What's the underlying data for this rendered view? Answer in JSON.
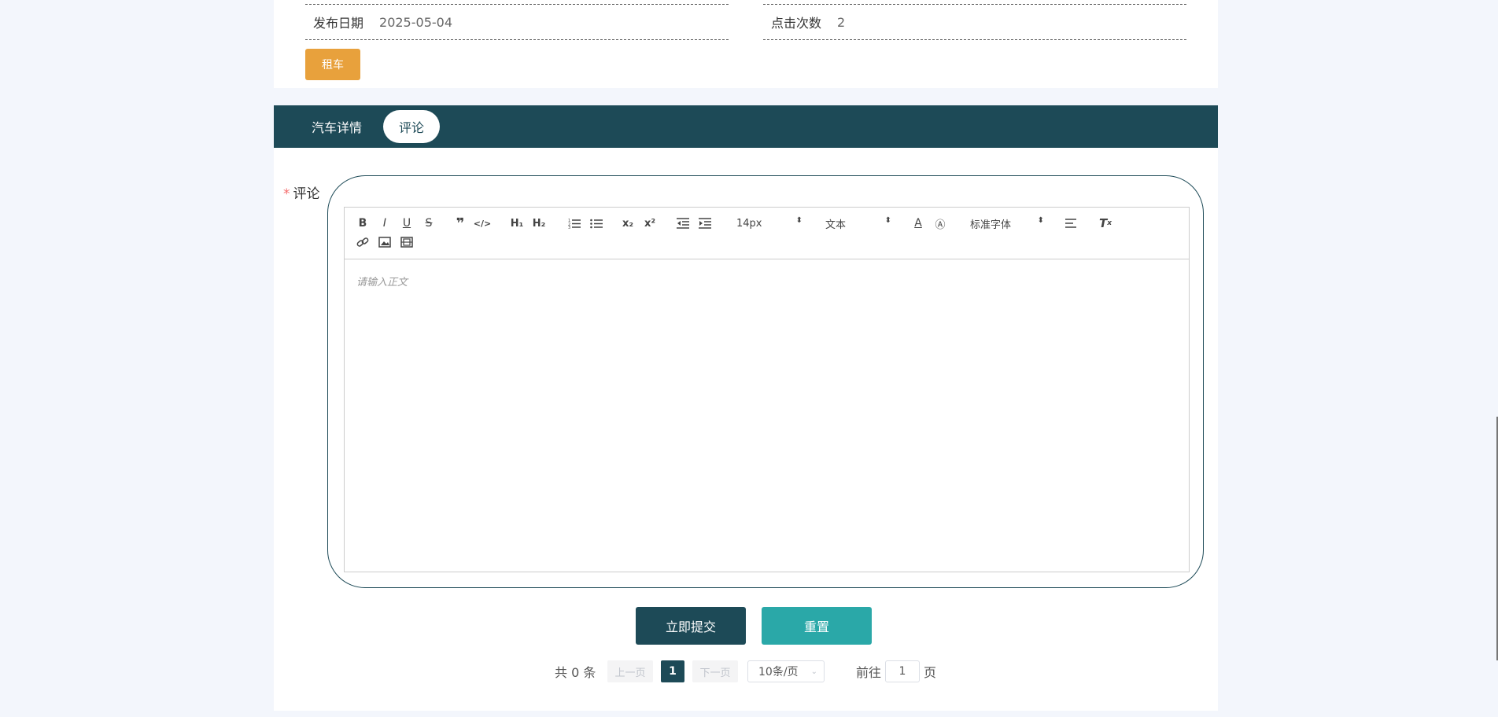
{
  "info": {
    "publish_date_label": "发布日期",
    "publish_date_value": "2025-05-04",
    "clicks_label": "点击次数",
    "clicks_value": "2"
  },
  "rent_button": "租车",
  "tabs": [
    {
      "label": "汽车详情",
      "active": false
    },
    {
      "label": "评论",
      "active": true
    }
  ],
  "form": {
    "required_mark": "*",
    "comment_label": "评论"
  },
  "editor": {
    "toolbar": {
      "bold": "B",
      "italic": "I",
      "underline": "U",
      "strike": "S",
      "h1": "H₁",
      "h2": "H₂",
      "subscript": "x₂",
      "superscript": "x²",
      "size_value": "14px",
      "header_value": "文本",
      "font_value": "标准字体"
    },
    "placeholder": "请输入正文"
  },
  "buttons": {
    "submit": "立即提交",
    "reset": "重置"
  },
  "pagination": {
    "total_text": "共 0 条",
    "prev": "上一页",
    "current_page": "1",
    "next": "下一页",
    "page_size": "10条/页",
    "goto_prefix": "前往",
    "goto_value": "1",
    "goto_suffix": "页"
  },
  "colors": {
    "primary": "#1d4a57",
    "rent": "#e8a13c",
    "reset": "#2aa8a8",
    "required": "#f56c6c"
  }
}
